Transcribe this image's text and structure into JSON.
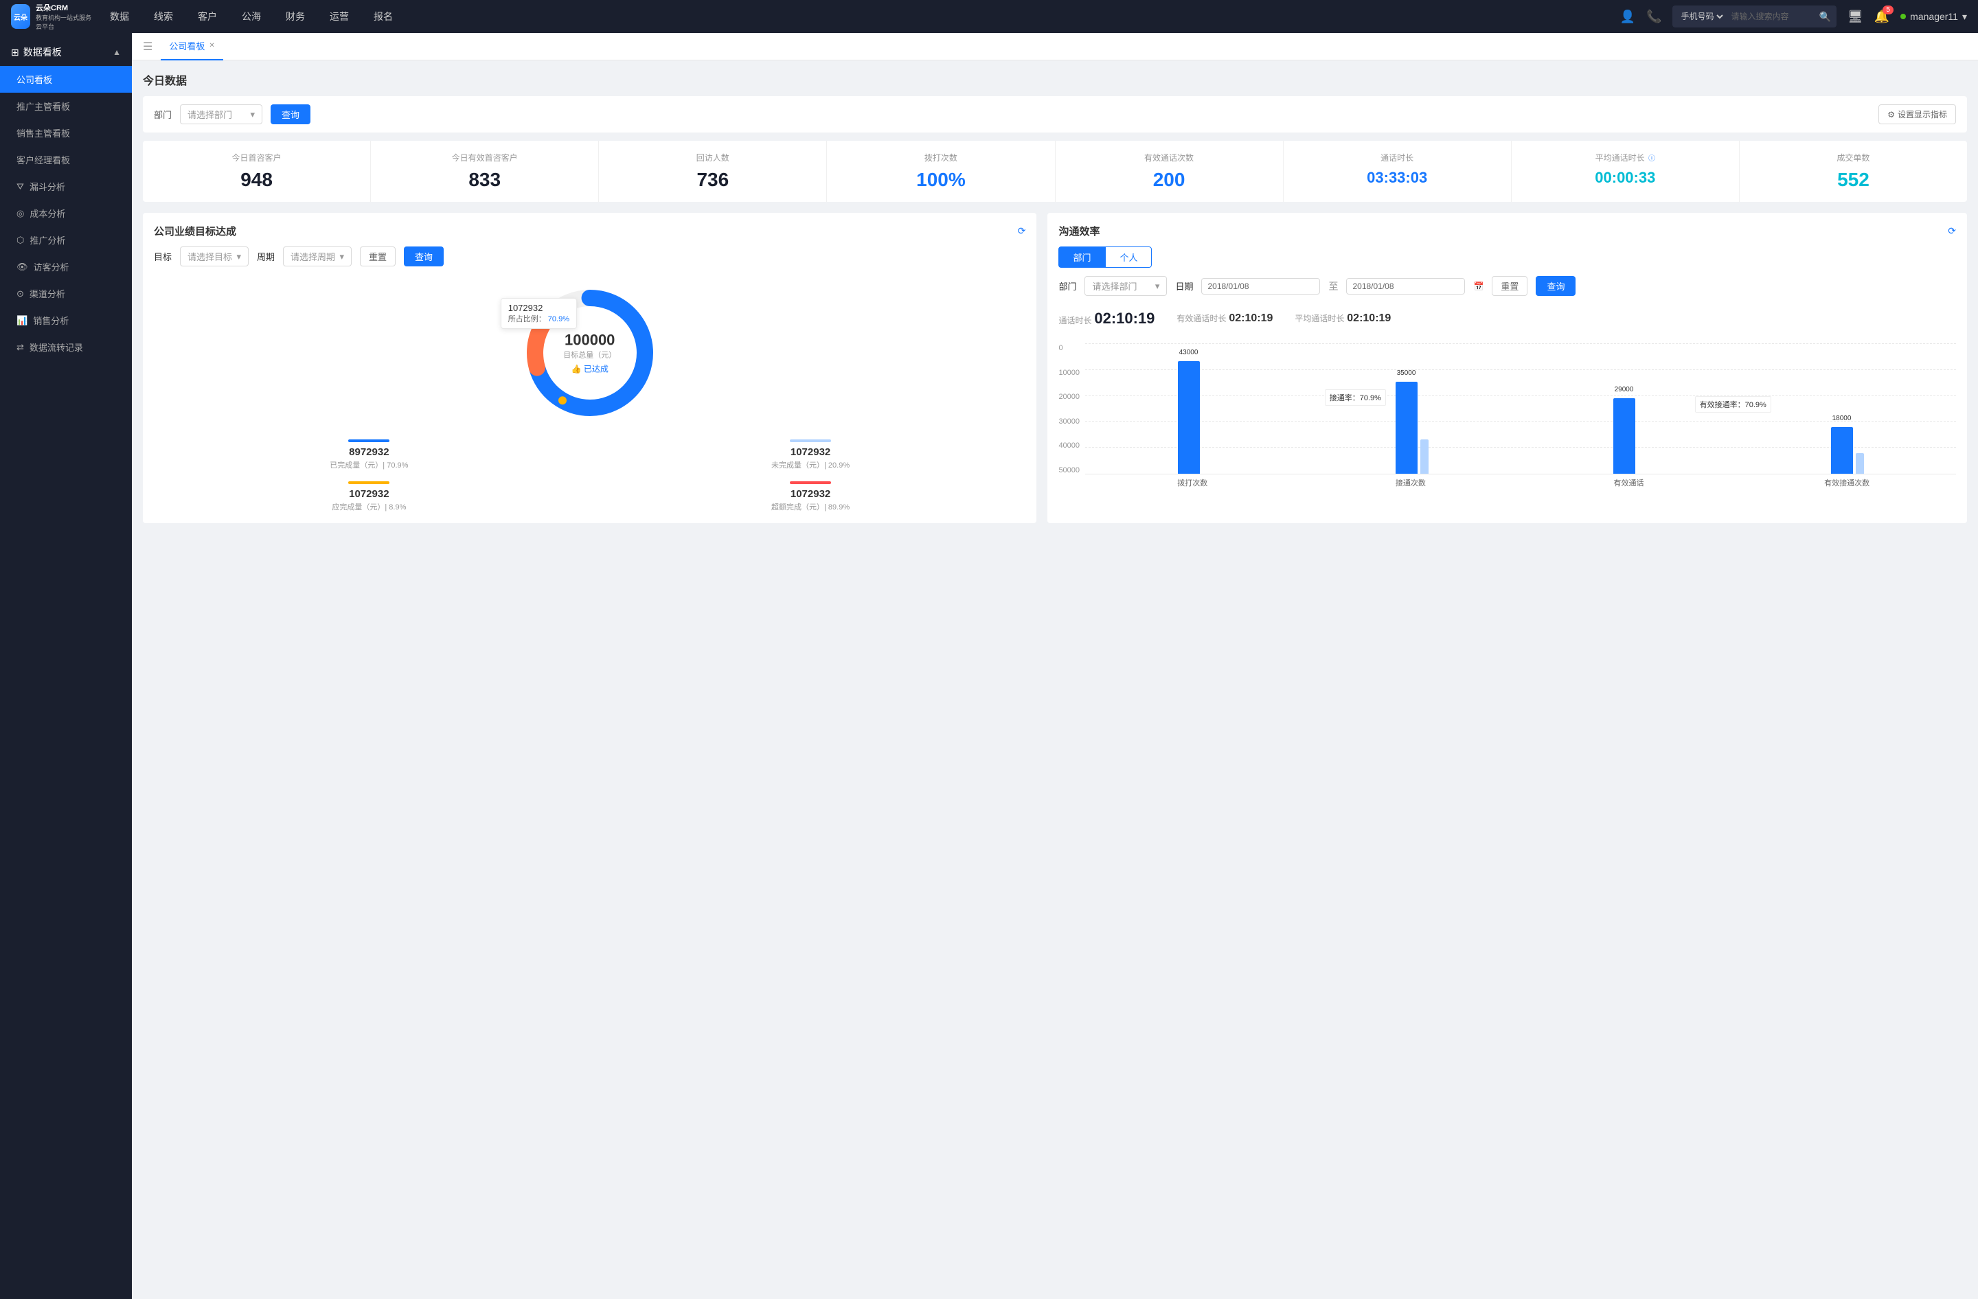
{
  "topNav": {
    "logo": {
      "line1": "云朵CRM",
      "line2": "教育机构一站式服务云平台"
    },
    "navItems": [
      "数据",
      "线索",
      "客户",
      "公海",
      "财务",
      "运营",
      "报名"
    ],
    "searchPlaceholder": "请输入搜索内容",
    "searchSelect": "手机号码",
    "badgeCount": "5",
    "username": "manager11"
  },
  "sidebar": {
    "header": "数据看板",
    "items": [
      {
        "label": "公司看板",
        "active": true
      },
      {
        "label": "推广主管看板",
        "active": false
      },
      {
        "label": "销售主管看板",
        "active": false
      },
      {
        "label": "客户经理看板",
        "active": false
      },
      {
        "label": "漏斗分析",
        "active": false
      },
      {
        "label": "成本分析",
        "active": false
      },
      {
        "label": "推广分析",
        "active": false
      },
      {
        "label": "访客分析",
        "active": false
      },
      {
        "label": "渠道分析",
        "active": false
      },
      {
        "label": "销售分析",
        "active": false
      },
      {
        "label": "数据流转记录",
        "active": false
      }
    ]
  },
  "tabs": [
    {
      "label": "公司看板",
      "active": true,
      "closable": true
    }
  ],
  "todayData": {
    "title": "今日数据",
    "filter": {
      "label": "部门",
      "placeholder": "请选择部门",
      "queryBtn": "查询",
      "settingsBtn": "设置显示指标"
    },
    "stats": [
      {
        "label": "今日首咨客户",
        "value": "948",
        "color": "dark"
      },
      {
        "label": "今日有效首咨客户",
        "value": "833",
        "color": "dark"
      },
      {
        "label": "回访人数",
        "value": "736",
        "color": "dark"
      },
      {
        "label": "拨打次数",
        "value": "100%",
        "color": "blue"
      },
      {
        "label": "有效通话次数",
        "value": "200",
        "color": "blue"
      },
      {
        "label": "通话时长",
        "value": "03:33:03",
        "color": "blue"
      },
      {
        "label": "平均通话时长",
        "value": "00:00:33",
        "color": "cyan"
      },
      {
        "label": "成交单数",
        "value": "552",
        "color": "cyan"
      }
    ]
  },
  "goalPanel": {
    "title": "公司业绩目标达成",
    "targetLabel": "目标",
    "targetPlaceholder": "请选择目标",
    "periodLabel": "周期",
    "periodPlaceholder": "请选择周期",
    "resetBtn": "重置",
    "queryBtn": "查询",
    "donut": {
      "centerValue": "100000",
      "centerLabel": "目标总量（元）",
      "centerBadge": "👍 已达成",
      "tooltip": {
        "value": "1072932",
        "pctLabel": "所占比例：",
        "pct": "70.9%"
      }
    },
    "stats": [
      {
        "barColor": "#1677ff",
        "value": "8972932",
        "desc": "已完成量（元）| 70.9%"
      },
      {
        "barColor": "#b3d4ff",
        "value": "1072932",
        "desc": "未完成量（元）| 20.9%"
      },
      {
        "barColor": "#ffb300",
        "value": "1072932",
        "desc": "应完成量（元）| 8.9%"
      },
      {
        "barColor": "#ff4d4f",
        "value": "1072932",
        "desc": "超额完成（元）| 89.9%"
      }
    ]
  },
  "effPanel": {
    "title": "沟通效率",
    "tabs": [
      "部门",
      "个人"
    ],
    "activeTab": 0,
    "deptLabel": "部门",
    "deptPlaceholder": "请选择部门",
    "dateLabel": "日期",
    "dateStart": "2018/01/08",
    "dateSep": "至",
    "dateEnd": "2018/01/08",
    "resetBtn": "重置",
    "queryBtn": "查询",
    "timeStats": {
      "talkTime": {
        "label": "通话时长",
        "value": "02:10:19"
      },
      "effTalkTime": {
        "label": "有效通话时长",
        "value": "02:10:19"
      },
      "avgTalkTime": {
        "label": "平均通话时长",
        "value": "02:10:19"
      }
    },
    "chart": {
      "yLabels": [
        "0",
        "10000",
        "20000",
        "30000",
        "40000",
        "50000"
      ],
      "groups": [
        {
          "label": "拨打次数",
          "bars": [
            {
              "value": 43000,
              "height": 86,
              "color": "blue",
              "labelTop": "43000"
            },
            {
              "value": 0,
              "height": 0,
              "color": "light"
            }
          ],
          "annotation": null
        },
        {
          "label": "接通次数",
          "bars": [
            {
              "value": 35000,
              "height": 70,
              "color": "blue",
              "labelTop": "35000"
            },
            {
              "value": 0,
              "height": 0,
              "color": "light"
            }
          ],
          "annotation": "接通率：70.9%"
        },
        {
          "label": "有效通话",
          "bars": [
            {
              "value": 29000,
              "height": 58,
              "color": "blue",
              "labelTop": "29000"
            },
            {
              "value": 0,
              "height": 0,
              "color": "light"
            }
          ],
          "annotation": null
        },
        {
          "label": "有效接通次数",
          "bars": [
            {
              "value": 18000,
              "height": 36,
              "color": "blue",
              "labelTop": "18000"
            },
            {
              "value": 4000,
              "height": 8,
              "color": "light"
            }
          ],
          "annotation": "有效接通率：70.9%"
        }
      ]
    }
  }
}
